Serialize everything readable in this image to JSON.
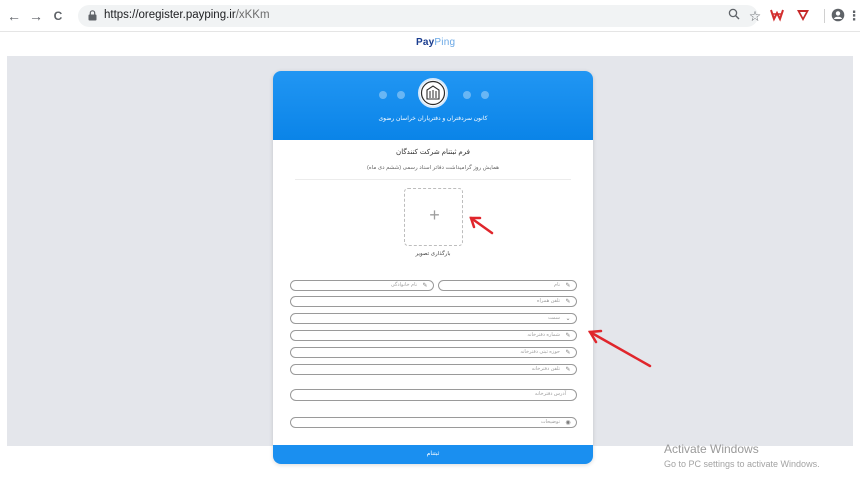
{
  "browser": {
    "url_host": "https://oregister.payping.ir",
    "url_path": "/xKKm",
    "back_icon": "←",
    "forward_icon": "→",
    "reload_icon": "C",
    "zoom_icon": "🔍",
    "star_icon": "☆",
    "profile_icon": "●",
    "menu_icon": "⋮"
  },
  "site": {
    "brand_main": "Pay",
    "brand_light": "Ping"
  },
  "card": {
    "org_name": "کانون سردفتران و دفتریاران خراسان رضوی",
    "form_title": "فرم ثبتنام شرکت کنندگان",
    "form_subtitle": "همایش روز گرامیداشت دفاتر اسناد رسمی (ششم دی ماه)",
    "upload_plus": "+",
    "upload_label": "بارگذاری تصویر",
    "fields": {
      "first_name": "نام",
      "last_name": "نام خانوادگی",
      "mobile": "تلفن همراه",
      "position": "سمت",
      "office_number": "شماره دفترخانه",
      "office_area": "حوزه ثبتی دفترخانه",
      "office_phone": "تلفن دفترخانه",
      "office_address": "آدرس دفترخانه",
      "notes": "توضیحات"
    },
    "submit_label": "ثبتنام"
  },
  "watermark": {
    "line1": "Activate Windows",
    "line2": "Go to PC settings to activate Windows."
  },
  "colors": {
    "header_blue": "#1a8ff0",
    "annotation_red": "#e0262c"
  }
}
